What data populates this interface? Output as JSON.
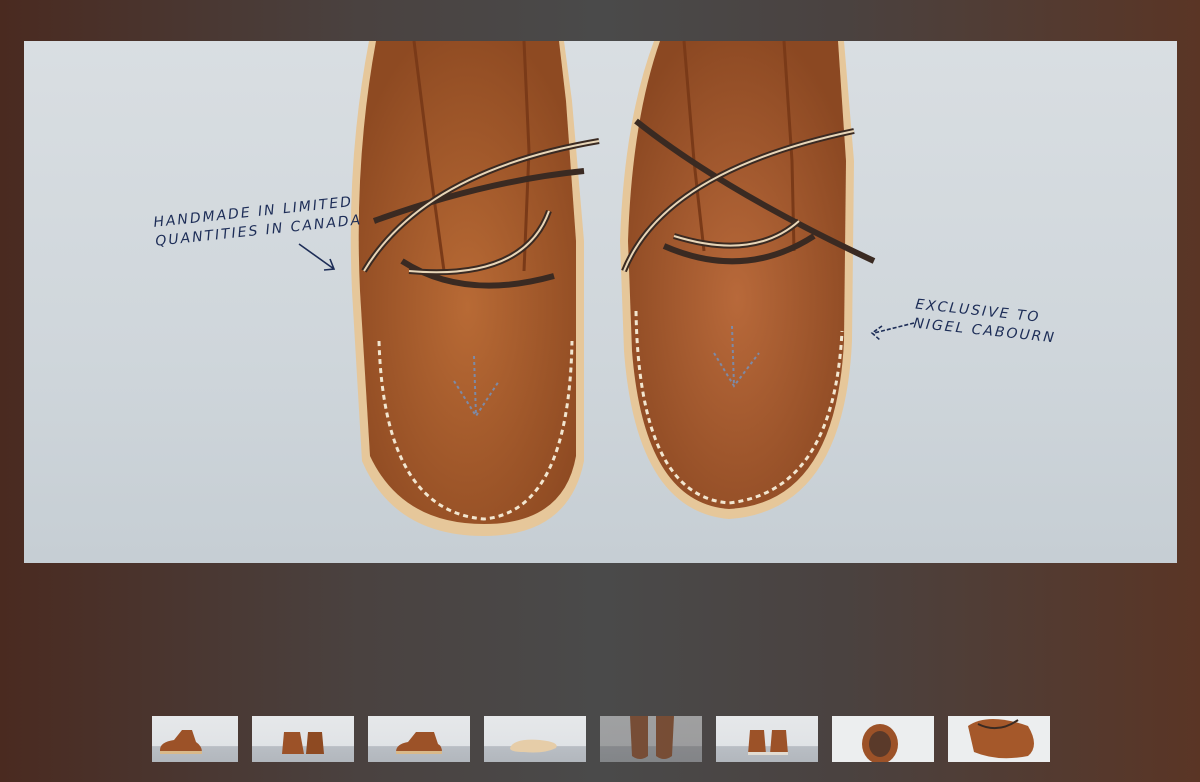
{
  "main_image": {
    "annotation_left": [
      "HANDMADE IN LIMITED",
      "QUANTITIES IN CANADA"
    ],
    "annotation_right": [
      "EXCLUSIVE TO",
      "NIGEL CABOURN"
    ]
  },
  "thumbnails": [
    {
      "name": "thumb-side-view",
      "selected": false
    },
    {
      "name": "thumb-rear-pair",
      "selected": false
    },
    {
      "name": "thumb-side-pair",
      "selected": false
    },
    {
      "name": "thumb-sole",
      "selected": false
    },
    {
      "name": "thumb-top-pair",
      "selected": true
    },
    {
      "name": "thumb-front-pair",
      "selected": false
    },
    {
      "name": "thumb-insole",
      "selected": false
    },
    {
      "name": "thumb-closeup",
      "selected": false
    }
  ],
  "colors": {
    "suede": "#a5582a",
    "lace": "#3a2a22",
    "ink": "#1d2d57"
  }
}
